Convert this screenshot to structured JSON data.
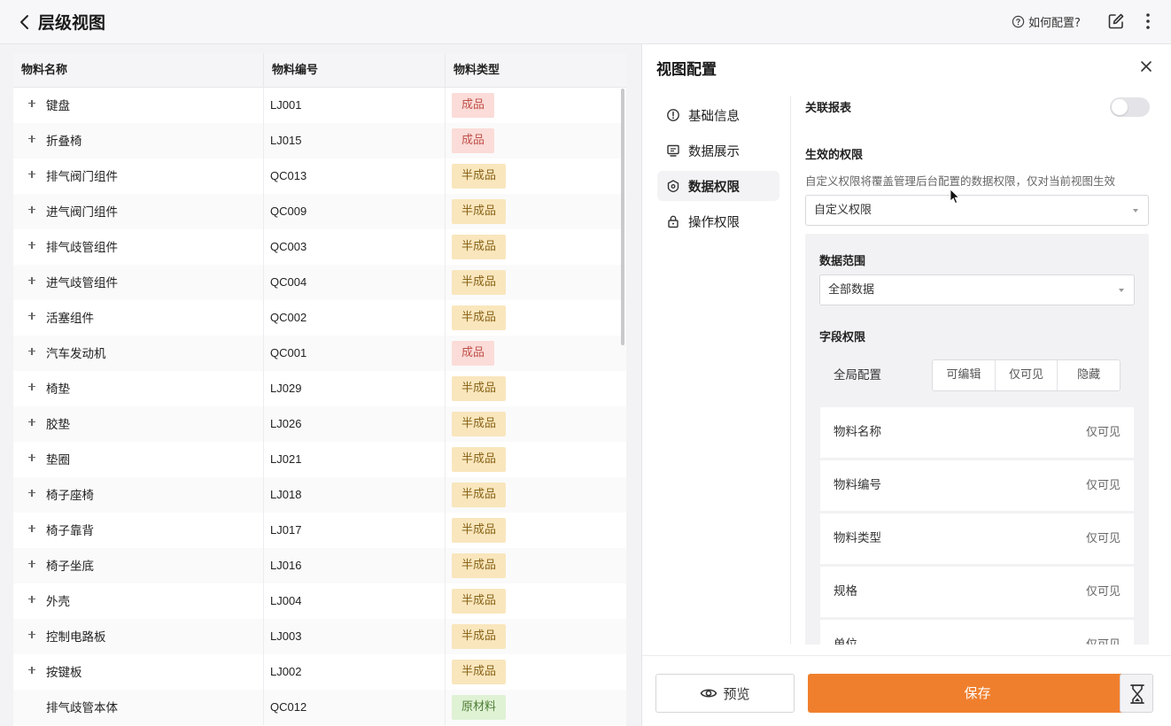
{
  "header": {
    "title": "层级视图",
    "help_label": "如何配置?"
  },
  "table": {
    "columns": [
      "物料名称",
      "物料编号",
      "物料类型"
    ],
    "rows": [
      {
        "name": "键盘",
        "code": "LJ001",
        "type": "成品",
        "expandable": true
      },
      {
        "name": "折叠椅",
        "code": "LJ015",
        "type": "成品",
        "expandable": true
      },
      {
        "name": "排气阀门组件",
        "code": "QC013",
        "type": "半成品",
        "expandable": true
      },
      {
        "name": "进气阀门组件",
        "code": "QC009",
        "type": "半成品",
        "expandable": true
      },
      {
        "name": "排气歧管组件",
        "code": "QC003",
        "type": "半成品",
        "expandable": true
      },
      {
        "name": "进气歧管组件",
        "code": "QC004",
        "type": "半成品",
        "expandable": true
      },
      {
        "name": "活塞组件",
        "code": "QC002",
        "type": "半成品",
        "expandable": true
      },
      {
        "name": "汽车发动机",
        "code": "QC001",
        "type": "成品",
        "expandable": true
      },
      {
        "name": "椅垫",
        "code": "LJ029",
        "type": "半成品",
        "expandable": true
      },
      {
        "name": "胶垫",
        "code": "LJ026",
        "type": "半成品",
        "expandable": true
      },
      {
        "name": "垫圈",
        "code": "LJ021",
        "type": "半成品",
        "expandable": true
      },
      {
        "name": "椅子座椅",
        "code": "LJ018",
        "type": "半成品",
        "expandable": true
      },
      {
        "name": "椅子靠背",
        "code": "LJ017",
        "type": "半成品",
        "expandable": true
      },
      {
        "name": "椅子坐底",
        "code": "LJ016",
        "type": "半成品",
        "expandable": true
      },
      {
        "name": "外壳",
        "code": "LJ004",
        "type": "半成品",
        "expandable": true
      },
      {
        "name": "控制电路板",
        "code": "LJ003",
        "type": "半成品",
        "expandable": true
      },
      {
        "name": "按键板",
        "code": "LJ002",
        "type": "半成品",
        "expandable": true
      },
      {
        "name": "排气歧管本体",
        "code": "QC012",
        "type": "原材料",
        "expandable": false
      }
    ],
    "type_colors": {
      "成品": {
        "bg": "#fbdcd8",
        "fg": "#c0504a"
      },
      "半成品": {
        "bg": "#f9e6bd",
        "fg": "#8a6418"
      },
      "原材料": {
        "bg": "#dff2d4",
        "fg": "#4d7c34"
      }
    }
  },
  "panel": {
    "title": "视图配置",
    "nav": [
      {
        "label": "基础信息",
        "icon": "info-icon",
        "active": false
      },
      {
        "label": "数据展示",
        "icon": "display-icon",
        "active": false
      },
      {
        "label": "数据权限",
        "icon": "data-permission-icon",
        "active": true
      },
      {
        "label": "操作权限",
        "icon": "lock-icon",
        "active": false
      }
    ],
    "linked_report_label": "关联报表",
    "linked_report_enabled": false,
    "effective_permission_label": "生效的权限",
    "effective_permission_hint": "自定义权限将覆盖管理后台配置的数据权限，仅对当前视图生效",
    "permission_select_value": "自定义权限",
    "data_scope_label": "数据范围",
    "data_scope_value": "全部数据",
    "field_permission_label": "字段权限",
    "global_config_label": "全局配置",
    "segment_options": [
      "可编辑",
      "仅可见",
      "隐藏"
    ],
    "fields": [
      {
        "name": "物料名称",
        "permission": "仅可见"
      },
      {
        "name": "物料编号",
        "permission": "仅可见"
      },
      {
        "name": "物料类型",
        "permission": "仅可见"
      },
      {
        "name": "规格",
        "permission": "仅可见"
      },
      {
        "name": "单位",
        "permission": "仅可见"
      }
    ],
    "preview_label": "预览",
    "save_label": "保存"
  },
  "accent_color": "#f07f2d"
}
